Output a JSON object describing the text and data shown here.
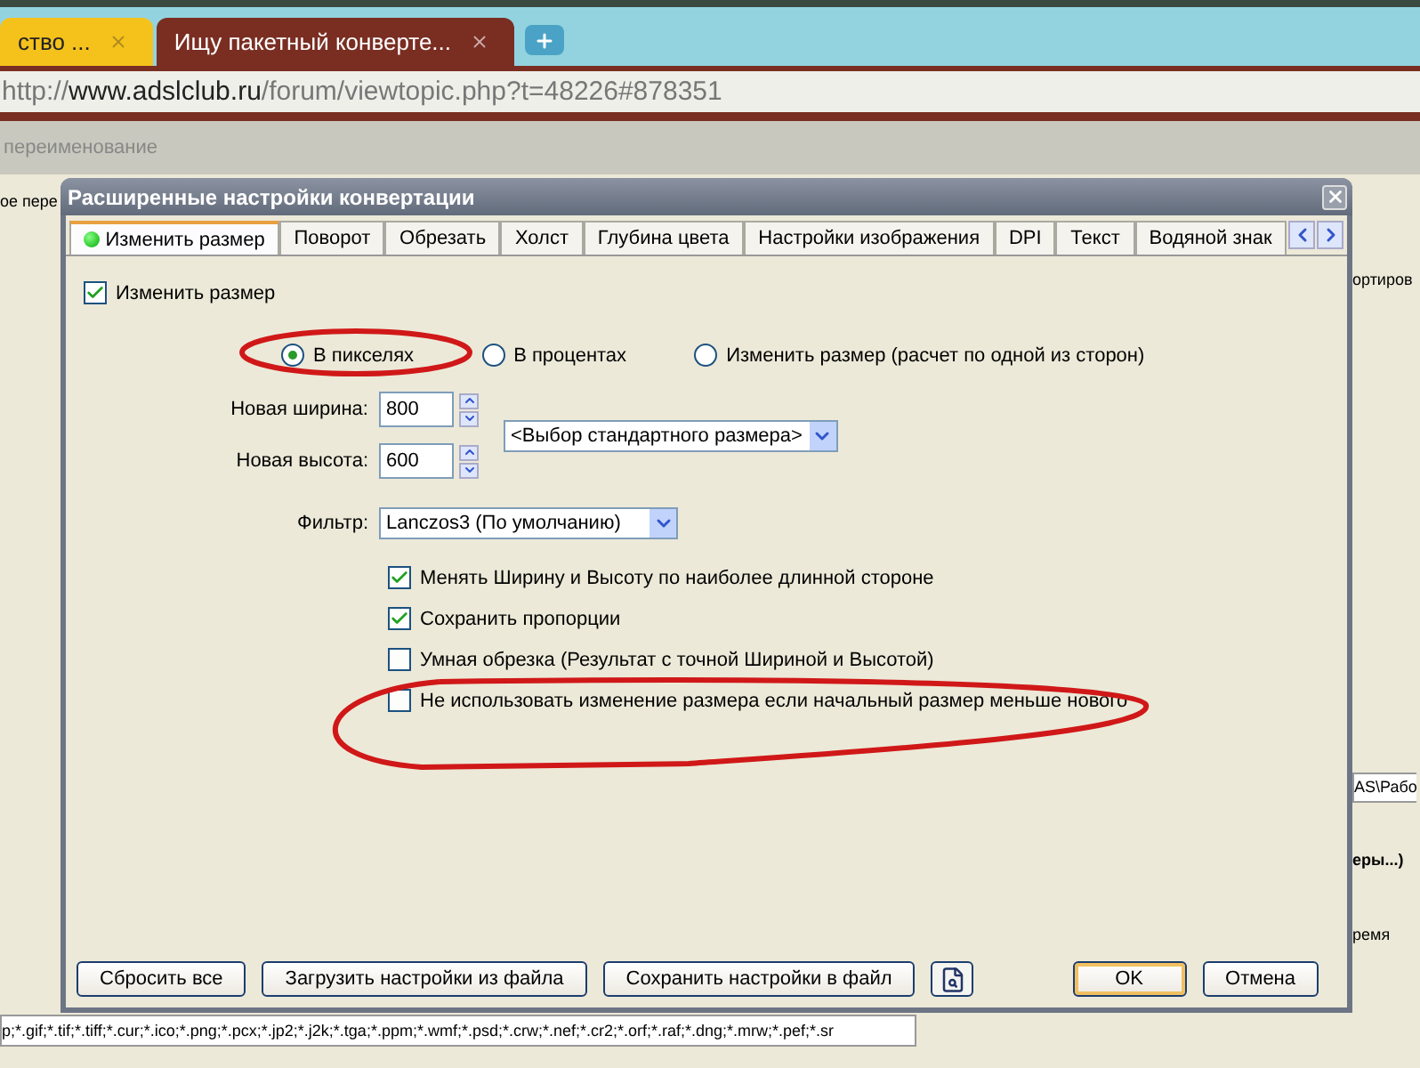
{
  "browser": {
    "tabs": [
      {
        "title": "ство ...",
        "selected": false
      },
      {
        "title": "Ищу пакетный конверте...",
        "selected": true
      }
    ],
    "address": {
      "scheme": "http://",
      "domain": "www.adslclub.ru",
      "path": "/forum/viewtopic.php?t=48226#878351"
    }
  },
  "background_app": {
    "section_title": "переименование",
    "left_label": "ое пере",
    "column_header": "ортиров",
    "path_field": "AS\\Рабо",
    "bold_label": "еры...)",
    "label": "ремя",
    "filter_combo": "p;*.gif;*.tif;*.tiff;*.cur;*.ico;*.png;*.pcx;*.jp2;*.j2k;*.tga;*.ppm;*.wmf;*.psd;*.crw;*.nef;*.cr2;*.orf;*.raf;*.dng;*.mrw;*.pef;*.sr"
  },
  "dialog": {
    "title": "Расширенные настройки конвертации",
    "tabs": [
      {
        "label": "Изменить размер",
        "selected": true
      },
      {
        "label": "Поворот",
        "selected": false
      },
      {
        "label": "Обрезать",
        "selected": false
      },
      {
        "label": "Холст",
        "selected": false
      },
      {
        "label": "Глубина цвета",
        "selected": false
      },
      {
        "label": "Настройки изображения",
        "selected": false
      },
      {
        "label": "DPI",
        "selected": false
      },
      {
        "label": "Текст",
        "selected": false
      },
      {
        "label": "Водяной знак",
        "selected": false
      }
    ],
    "resize_checkbox": {
      "label": "Изменить размер",
      "checked": true
    },
    "radios": [
      {
        "label": "В пикселях",
        "selected": true
      },
      {
        "label": "В процентах",
        "selected": false
      },
      {
        "label": "Изменить размер (расчет по одной из сторон)",
        "selected": false
      }
    ],
    "width": {
      "label": "Новая ширина:",
      "value": "800"
    },
    "height": {
      "label": "Новая высота:",
      "value": "600"
    },
    "preset": "<Выбор стандартного размера>",
    "filter": {
      "label": "Фильтр:",
      "value": "Lanczos3 (По умолчанию)"
    },
    "options": [
      {
        "label": "Менять Ширину и Высоту по наиболее длинной стороне",
        "checked": true
      },
      {
        "label": "Сохранить пропорции",
        "checked": true
      },
      {
        "label": "Умная обрезка (Результат с точной Шириной и Высотой)",
        "checked": false
      },
      {
        "label": "Не использовать изменение размера если начальный размер меньше нового",
        "checked": false
      }
    ],
    "left_buttons": [
      "Сбросить все",
      "Загрузить настройки из файла",
      "Сохранить настройки в файл"
    ],
    "ok": "OK",
    "cancel": "Отмена"
  }
}
